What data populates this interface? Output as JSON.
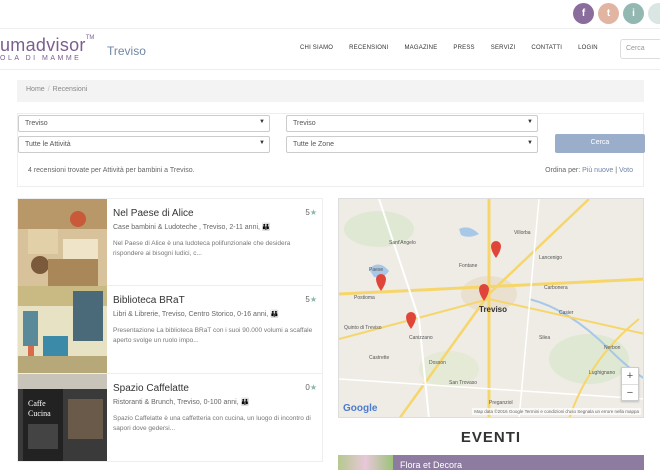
{
  "social": {
    "facebook": "f",
    "twitter": "t",
    "instagram": "i"
  },
  "header": {
    "logo_main": "umadvisor",
    "logo_tm": "TM",
    "logo_sub": "OLA DI MAMME",
    "city": "Treviso",
    "nav": [
      "CHI SIAMO",
      "RECENSIONI",
      "MAGAZINE",
      "PRESS",
      "SERVIZI",
      "CONTATTI",
      "LOGIN"
    ],
    "search_placeholder": "Cerca"
  },
  "breadcrumb": {
    "home": "Home",
    "sep": "/",
    "current": "Recensioni"
  },
  "filters": {
    "city_left": "Treviso",
    "city_right": "Treviso",
    "activity": "Tutte le Attività",
    "zone": "Tutte le Zone",
    "search_button": "Cerca",
    "results_info": "4 recensioni trovate per Attività per bambini a Treviso.",
    "order_label": "Ordina per:",
    "order_new": "Più nuove",
    "order_sep": "|",
    "order_vote": "Voto"
  },
  "items": [
    {
      "title": "Nel Paese di Alice",
      "rating": "5",
      "category": "Case bambini & Ludoteche , Treviso, 2-11 anni,",
      "description": "Nel Paese di Alice è una ludoteca polifunzionale che desidera rispondere ai bisogni ludici, c..."
    },
    {
      "title": "Biblioteca BRaT",
      "rating": "5",
      "category": "Libri & Librerie, Treviso, Centro Storico, 0-16 anni,",
      "description": "Presentazione La biblioteca BRaT con i suoi 90.000 volumi a scaffale aperto svolge un ruolo impo..."
    },
    {
      "title": "Spazio Caffelatte",
      "rating": "0",
      "category": "Ristoranti & Brunch, Treviso, 0-100 anni,",
      "description": "Spazio Caffelatte è una caffetteria con cucina, un luogo di incontro di sapori dove gedersi..."
    }
  ],
  "map": {
    "labels": [
      "Paese",
      "Treviso",
      "Fontane",
      "Villorba",
      "Preganziol",
      "Silea",
      "Casier",
      "Quinto di Treviso",
      "Castrette",
      "Lancenigo",
      "Carbonera",
      "Dosson",
      "Lughignano",
      "Nerbon",
      "San Trovaso",
      "Postioma",
      "Canizzano",
      "Sant'Angelo"
    ],
    "google": "Google",
    "footer": "Map data ©2016 Google   Termini e condizioni d'uso   Segnala un errore nella mappa",
    "zoom_in": "+",
    "zoom_out": "−"
  },
  "events": {
    "title": "EVENTI",
    "first_event": "Flora et Decora"
  }
}
